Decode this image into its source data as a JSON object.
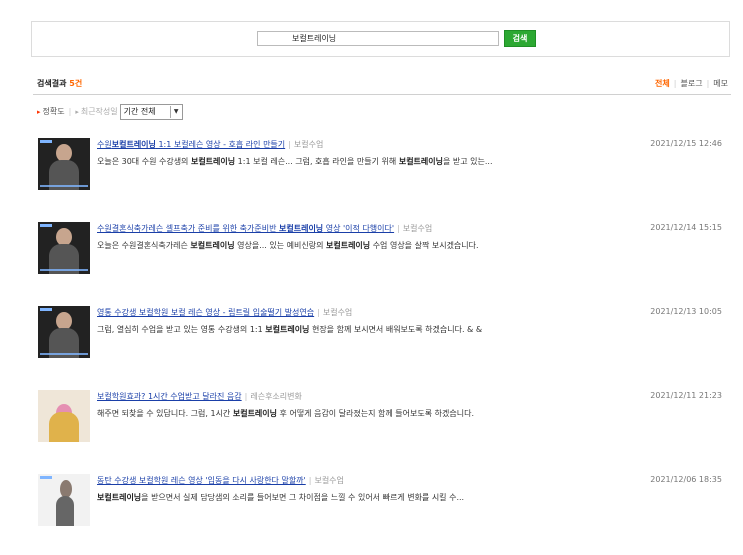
{
  "search": {
    "query": "보컬트레이닝",
    "button_label": "검색"
  },
  "results_header": {
    "label": "검색결과",
    "count": "5건"
  },
  "filter_tabs": [
    {
      "label": "전체",
      "active": true
    },
    {
      "label": "블로그",
      "active": false
    },
    {
      "label": "메모",
      "active": false
    }
  ],
  "sort": {
    "accuracy": "정확도",
    "recent": "최근작성일",
    "period": "기간 전체"
  },
  "results": [
    {
      "title_pre": "수원",
      "title_bold": "보컬트레이닝",
      "title_post": " 1:1 보컬레슨 영상 - 호흡 라인 만들기",
      "category": "보컬수업",
      "desc_pre": "오늘은 30대 수원 수강생의 ",
      "desc_bold": "보컬트레이닝",
      "desc_mid": " 1:1 보컬 레슨... 그럼, 호흡 라인을 만들기 위해 ",
      "desc_bold2": "보컬트레이닝",
      "desc_post": "을 받고 있는...",
      "date": "2021/12/15 12:46",
      "thumb_icon": "video-thumbnail-icon"
    },
    {
      "title_pre": "수원결혼식축가레슨 셀프축가 준비를 위한 축가준비반 ",
      "title_bold": "보컬트레이닝",
      "title_post": " 영상 '이적 다행이다'",
      "category": "보컬수업",
      "desc_pre": "오늘은 수원결혼식축가레슨 ",
      "desc_bold": "보컬트레이닝",
      "desc_mid": " 영상을... 있는 예비신랑의 ",
      "desc_bold2": "보컬트레이닝",
      "desc_post": " 수업 영상을 살짝 보시겠습니다.",
      "date": "2021/12/14 15:15",
      "thumb_icon": "video-thumbnail-icon"
    },
    {
      "title_pre": "영통 수강생 보컬학원 보컬 레슨 영상 - 립트릴 입술떨기 발성연습",
      "title_bold": "",
      "title_post": "",
      "category": "보컬수업",
      "desc_pre": "그럼, 열심히 수업을 받고 있는 영통 수강생의 1:1 ",
      "desc_bold": "보컬트레이닝",
      "desc_mid": " 현장을 함께 보시면서 배워보도록 하겠습니다. & &",
      "desc_bold2": "",
      "desc_post": "",
      "date": "2021/12/13 10:05",
      "thumb_icon": "video-thumbnail-icon"
    },
    {
      "title_pre": "보컬학원효과? 1시간 수업받고 달라진 음감",
      "title_bold": "",
      "title_post": "",
      "category": "레슨후소리변화",
      "desc_pre": "해주면 되찾을 수 있답니다. 그럼, 1시간 ",
      "desc_bold": "보컬트레이닝",
      "desc_mid": " 후 어떻게 음감이 달라졌는지 함께 들어보도록 하겠습니다.",
      "desc_bold2": "",
      "desc_post": "",
      "date": "2021/12/11 21:23",
      "thumb_icon": "image-thumbnail-icon"
    },
    {
      "title_pre": "동탄 수강생 보컬학원 레슨 영상 '입동을 다시 사랑한다 말할까'",
      "title_bold": "",
      "title_post": "",
      "category": "보컬수업",
      "desc_pre": "",
      "desc_bold": "보컬트레이닝",
      "desc_mid": "을 받으면서 실제 담당샘의 소리를 들어보면 그 차이점을 느낄 수 있어서 빠르게 변화를 시킬 수...",
      "desc_bold2": "",
      "desc_post": "",
      "date": "2021/12/06 18:35",
      "thumb_icon": "video-thumbnail-icon"
    }
  ]
}
